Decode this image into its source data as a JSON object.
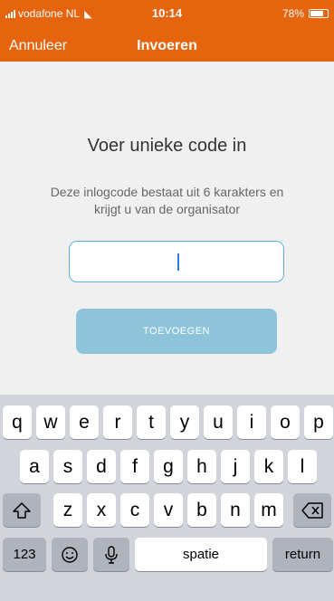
{
  "status_bar": {
    "carrier": "vodafone NL",
    "time": "10:14",
    "battery": "78%",
    "battery_level": 0.78
  },
  "nav": {
    "cancel_label": "Annuleer",
    "title": "Invoeren"
  },
  "main": {
    "heading": "Voer unieke code in",
    "description": "Deze inlogcode bestaat uit 6 karakters en krijgt u van de organisator",
    "code_input_value": "",
    "add_button_label": "TOEVOEGEN"
  },
  "keyboard": {
    "row1": [
      "q",
      "w",
      "e",
      "r",
      "t",
      "y",
      "u",
      "i",
      "o",
      "p"
    ],
    "row2": [
      "a",
      "s",
      "d",
      "f",
      "g",
      "h",
      "j",
      "k",
      "l"
    ],
    "row3": [
      "z",
      "x",
      "c",
      "v",
      "b",
      "n",
      "m"
    ],
    "numbers_label": "123",
    "space_label": "spatie",
    "return_label": "return"
  },
  "colors": {
    "header": "#e7640f",
    "button": "#8ec4da",
    "input_border": "#5fb0d8",
    "frame": "#3fa34d"
  }
}
